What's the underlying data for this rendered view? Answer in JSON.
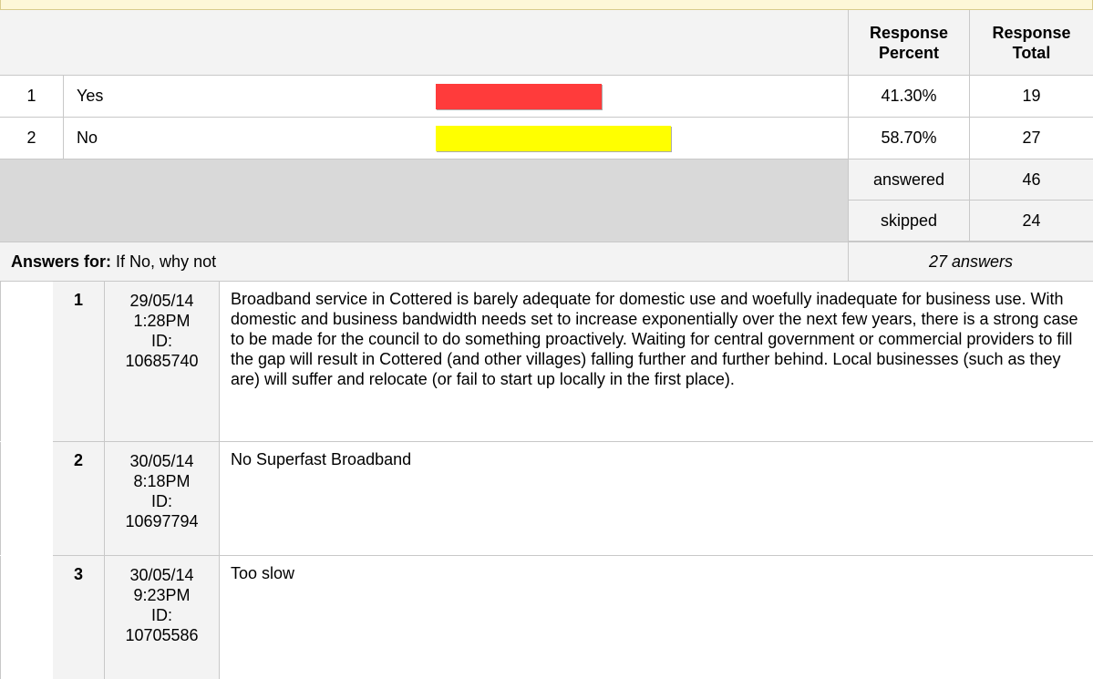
{
  "table": {
    "header": {
      "response_percent": "Response\nPercent",
      "response_total": "Response\nTotal"
    },
    "rows": [
      {
        "num": "1",
        "label": "Yes",
        "percent": "41.30%",
        "total": "19",
        "share": 0.413,
        "color": "#ff3b3b"
      },
      {
        "num": "2",
        "label": "No",
        "percent": "58.70%",
        "total": "27",
        "share": 0.587,
        "color": "#ffff00"
      }
    ],
    "summary": {
      "answered_label": "answered",
      "answered_value": "46",
      "skipped_label": "skipped",
      "skipped_value": "24"
    }
  },
  "answers": {
    "prefix": "Answers for:",
    "question": "If No, why not",
    "count": "27 answers",
    "items": [
      {
        "num": "1",
        "date": "29/05/14",
        "time": "1:28PM",
        "id_label": "ID:",
        "id": "10685740",
        "text": "Broadband service in Cottered is barely adequate for domestic use and woefully inadequate for business use. With domestic and business bandwidth needs set to increase exponentially over the next few years, there is a strong case to be made for the council to do something proactively. Waiting for central government or commercial providers to fill the gap will result in Cottered (and other villages) falling further and further behind. Local businesses (such as they are) will suffer and relocate (or fail to start up locally in the first place)."
      },
      {
        "num": "2",
        "date": "30/05/14",
        "time": "8:18PM",
        "id_label": "ID:",
        "id": "10697794",
        "text": "No Superfast Broadband"
      },
      {
        "num": "3",
        "date": "30/05/14",
        "time": "9:23PM",
        "id_label": "ID:",
        "id": "10705586",
        "text": "Too slow"
      }
    ]
  }
}
